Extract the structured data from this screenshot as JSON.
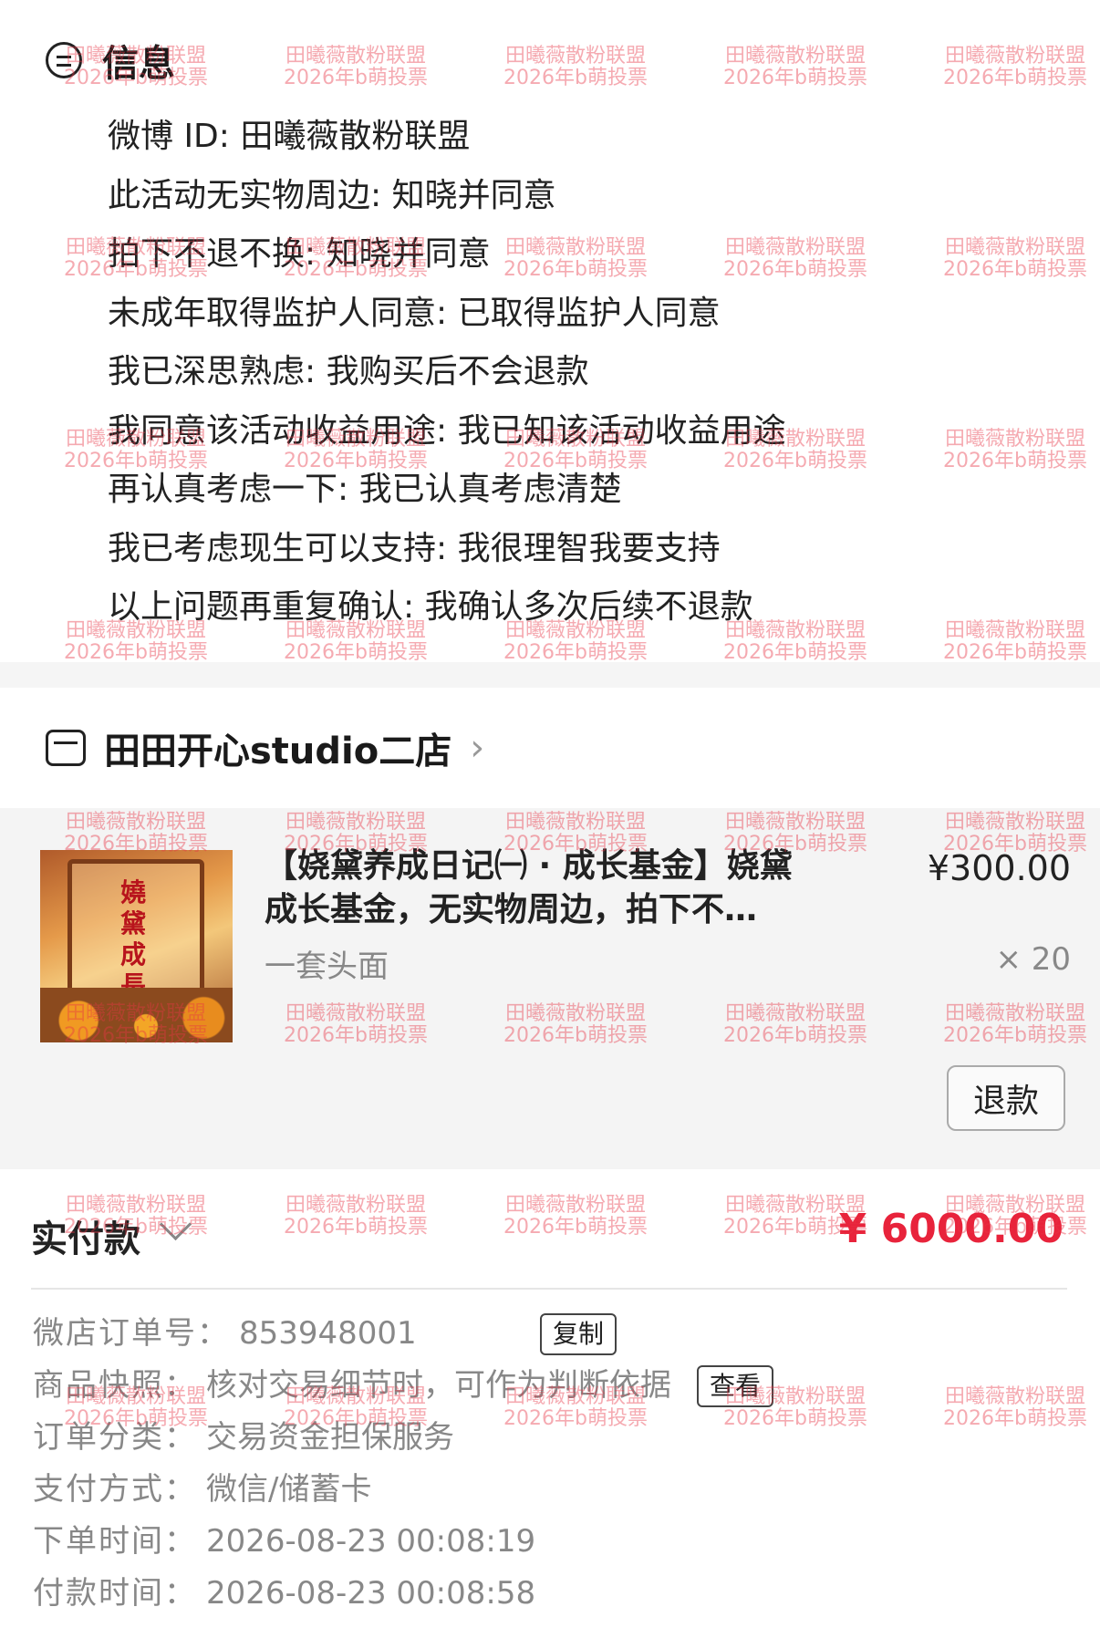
{
  "info": {
    "title": "信息",
    "lines": [
      "微博 ID: 田曦薇散粉联盟",
      "此活动无实物周边: 知晓并同意",
      "拍下不退不换: 知晓并同意",
      "未成年取得监护人同意: 已取得监护人同意",
      "我已深思熟虑: 我购买后不会退款",
      "我同意该活动收益用途: 我已知该活动收益用途",
      "再认真考虑一下: 我已认真考虑清楚",
      "我已考虑现生可以支持: 我很理智我要支持",
      "以上问题再重复确认: 我确认多次后续不退款"
    ]
  },
  "shop": {
    "name": "田田开心studio二店",
    "arrow": "›"
  },
  "product": {
    "image_text": "嬈黛成長基金",
    "title": "【娆黛养成日记㈠ · 成长基金】娆黛成长基金，无实物周边，拍下不…",
    "sku": "一套头面",
    "price": "¥300.00",
    "quantity": "× 20",
    "refund_label": "退款"
  },
  "payment": {
    "label": "实付款",
    "amount": "¥ 6000.00"
  },
  "order": {
    "rows": [
      {
        "key": "微店订单号：",
        "value": "853948001",
        "button": "复制"
      },
      {
        "key": "商品快照：",
        "value": "核对交易细节时，可作为判断依据",
        "button": "查看"
      },
      {
        "key": "订单分类：",
        "value": "交易资金担保服务"
      },
      {
        "key": "支付方式：",
        "value": "微信/储蓄卡"
      },
      {
        "key": "下单时间：",
        "value": "2026-08-23 00:08:19"
      },
      {
        "key": "付款时间：",
        "value": "2026-08-23 00:08:58"
      }
    ]
  },
  "watermark": {
    "line1": "田曦薇散粉联盟",
    "line2": "2026年b萌投票"
  },
  "colors": {
    "accent": "#e8233b",
    "watermark": "#e83446",
    "product_bg": "#f4f4f4"
  }
}
